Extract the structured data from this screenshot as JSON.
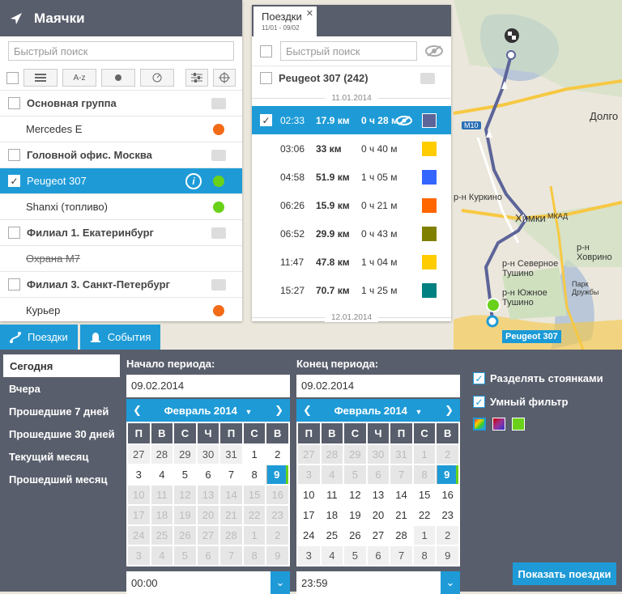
{
  "map": {
    "labels": [
      "Долго",
      "р-н Куркино",
      "Химки",
      "р-н Северное Тушино",
      "р-н Ховрино",
      "р-н Южное Тушино",
      "Парк Дружбы",
      "Химки",
      "МКАД"
    ],
    "road_badge": "М10",
    "vehicle_tag": "Peugeot 307"
  },
  "beacons": {
    "title": "Маячки",
    "search_placeholder": "Быстрый поиск",
    "sort_az": "A-z",
    "rows": [
      {
        "type": "group",
        "label": "Основная группа"
      },
      {
        "type": "item",
        "label": "Mercedes E",
        "dot": "#f36b16"
      },
      {
        "type": "group",
        "label": "Головной офис. Москва"
      },
      {
        "type": "selected",
        "label": "Peugeot 307",
        "dot": "#6ad11a"
      },
      {
        "type": "item",
        "label": "Shanxi (топливо)",
        "dot": "#6ad11a"
      },
      {
        "type": "group",
        "label": "Филиал 1. Екатеринбург"
      },
      {
        "type": "item-strike",
        "label": "Охрана М7"
      },
      {
        "type": "group",
        "label": "Филиал 3. Санкт-Петербург"
      },
      {
        "type": "item",
        "label": "Курьер",
        "dot": "#f36b16"
      }
    ]
  },
  "trips": {
    "tab_title": "Поездки",
    "tab_range": "11/01 - 09/02",
    "search_placeholder": "Быстрый поиск",
    "group_label": "Peugeot 307 (242)",
    "date_sep_1": "11.01.2014",
    "date_sep_2": "12.01.2014",
    "rows": [
      {
        "time": "02:33",
        "dist": "17.9 км",
        "dur": "0 ч 28 м",
        "color": "#5c6499",
        "selected": true
      },
      {
        "time": "03:06",
        "dist": "33 км",
        "dur": "0 ч 40 м",
        "color": "#ffcc00"
      },
      {
        "time": "04:58",
        "dist": "51.9 км",
        "dur": "1 ч 05 м",
        "color": "#3366ff"
      },
      {
        "time": "06:26",
        "dist": "15.9 км",
        "dur": "0 ч 21 м",
        "color": "#ff6600"
      },
      {
        "time": "06:52",
        "dist": "29.9 км",
        "dur": "0 ч 43 м",
        "color": "#808000"
      },
      {
        "time": "11:47",
        "dist": "47.8 км",
        "dur": "1 ч 04 м",
        "color": "#ffcc00"
      },
      {
        "time": "15:27",
        "dist": "70.7 км",
        "dur": "1 ч 25 м",
        "color": "#008080"
      }
    ]
  },
  "bottom_tabs": {
    "trips": "Поездки",
    "events": "События"
  },
  "presets": [
    "Сегодня",
    "Вчера",
    "Прошедшие 7 дней",
    "Прошедшие 30 дней",
    "Текущий месяц",
    "Прошедший месяц"
  ],
  "start": {
    "label": "Начало периода:",
    "date": "09.02.2014",
    "month": "Февраль 2014",
    "time": "00:00"
  },
  "end": {
    "label": "Конец периода:",
    "date": "09.02.2014",
    "month": "Февраль 2014",
    "time": "23:59"
  },
  "weekdays": [
    "П",
    "В",
    "С",
    "Ч",
    "П",
    "С",
    "В"
  ],
  "options": {
    "split_by_stops": "Разделять стоянками",
    "smart_filter": "Умный фильтр"
  },
  "show_button": "Показать поездки",
  "colors": {
    "accent": "#1e9bd7",
    "panel": "#595e6c",
    "route": "#5c6499"
  }
}
